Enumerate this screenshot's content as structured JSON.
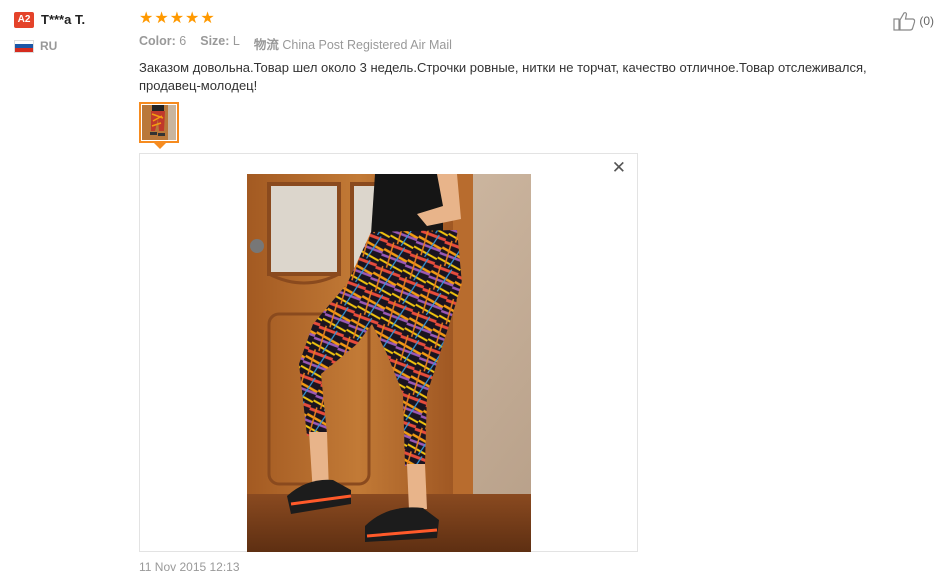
{
  "reviewer": {
    "level_badge": "A2",
    "name": "T***a T.",
    "country_code": "RU"
  },
  "rating": {
    "stars": 5,
    "max": 5
  },
  "helpful": {
    "count": "(0)"
  },
  "attributes": {
    "color_label": "Color:",
    "color_value": "6",
    "size_label": "Size:",
    "size_value": "L",
    "shipping_label": "物流",
    "shipping_value": "China Post Registered Air Mail"
  },
  "review_text": "Заказом довольна.Товар шел около 3 недель.Строчки ровные, нитки не торчат, качество отличное.Товар отслеживался, продавец-молодец!",
  "timestamp": "11 Nov 2015 12:13",
  "colors": {
    "accent": "#f68b1f",
    "star": "#ff9900",
    "badge": "#e4432a"
  }
}
